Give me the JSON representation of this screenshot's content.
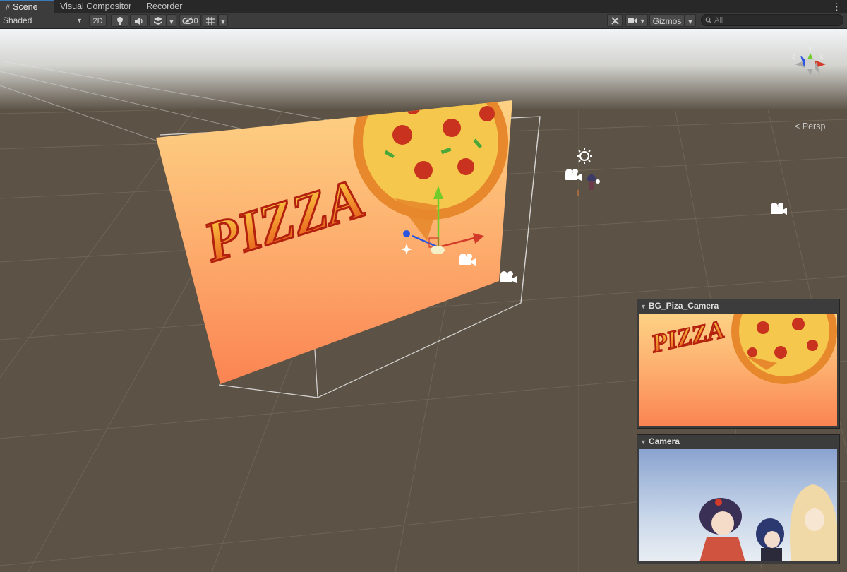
{
  "tabs": [
    {
      "label": "Scene",
      "icon": "grid-icon"
    },
    {
      "label": "Visual Compositor"
    },
    {
      "label": "Recorder"
    }
  ],
  "toolbar": {
    "shading_mode": "Shaded",
    "mode_2d": "2D",
    "hidden_count": "0",
    "gizmos_label": "Gizmos",
    "search_placeholder": "All",
    "icons": [
      "lightbulb-icon",
      "audio-icon",
      "effects-icon",
      "visibility-icon",
      "grid-snap-icon",
      "tools-icon",
      "camera-icon",
      "search-icon"
    ]
  },
  "scene": {
    "projection_label": "< Persp",
    "orientation_axes": {
      "x": "x",
      "y": "y",
      "z": "z"
    },
    "billboard_text": "PIZZA"
  },
  "previews": [
    {
      "title": "BG_Piza_Camera",
      "logo_text": "PIZZA"
    },
    {
      "title": "Camera"
    }
  ],
  "colors": {
    "scene_background": "#5c5346",
    "tab_accent": "#3a79bb",
    "axis_x": "#d23a2a",
    "axis_y": "#6fcc2a",
    "axis_z": "#2a55e0"
  }
}
